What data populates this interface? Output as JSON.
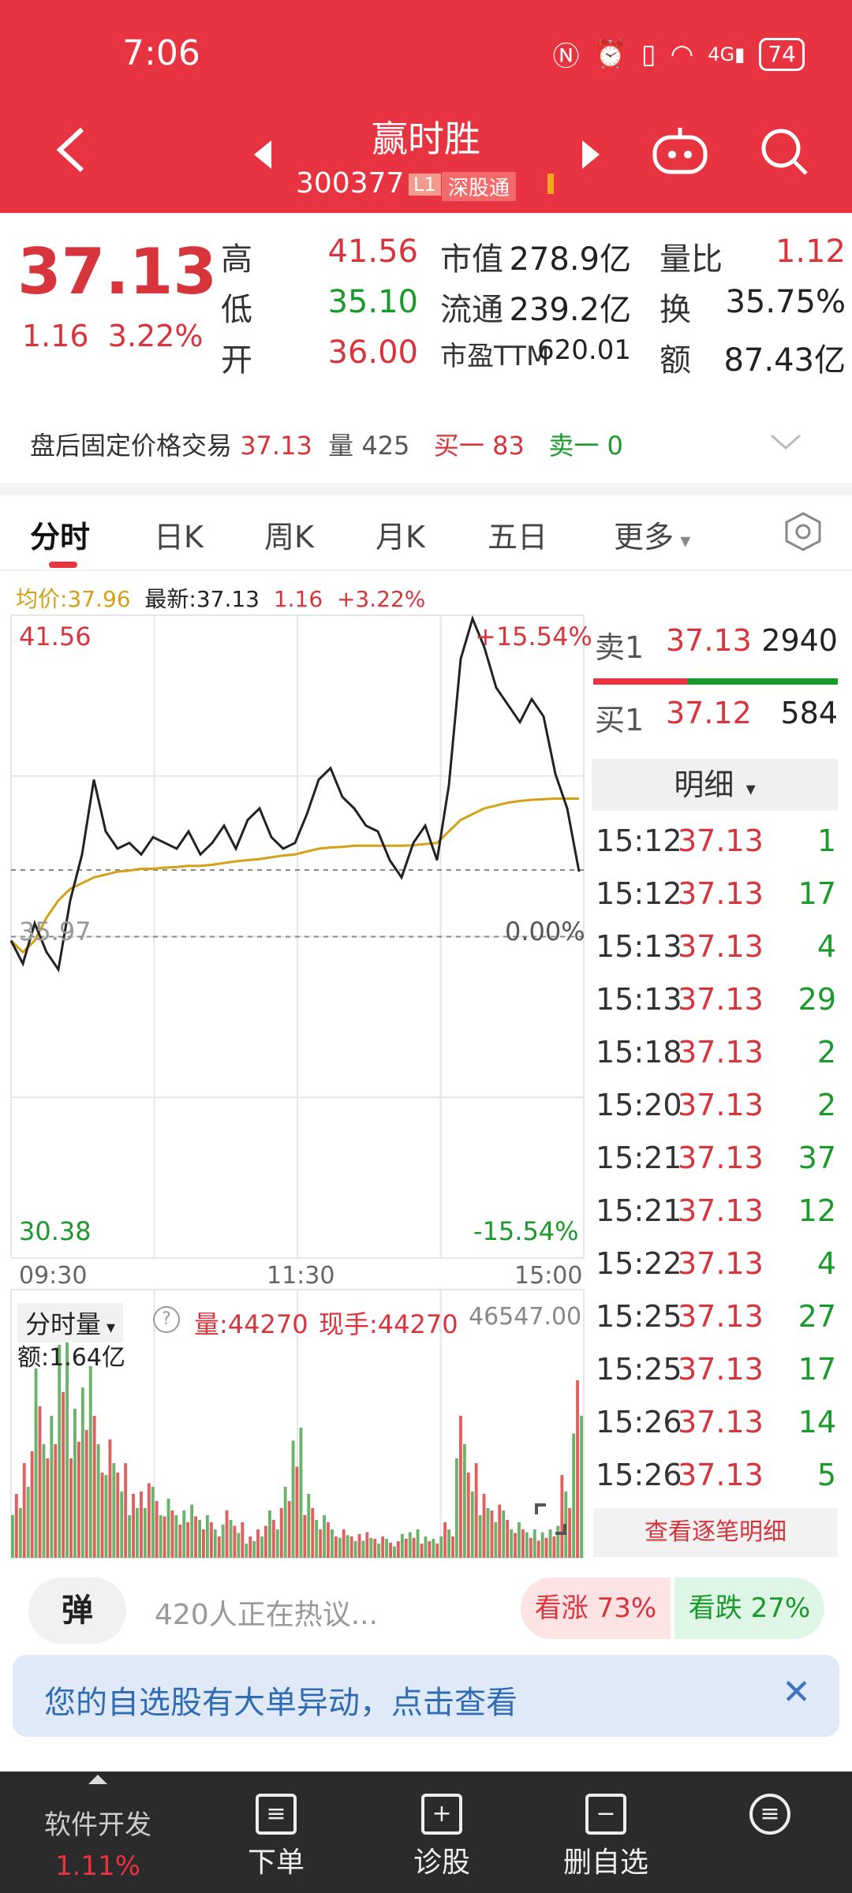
{
  "status_bar": {
    "time": "7:06",
    "icons": [
      "nfc-icon",
      "alarm-icon",
      "vibrate-icon",
      "wifi-icon",
      "signal-4g-icon"
    ],
    "battery": "74"
  },
  "header": {
    "name": "赢时胜",
    "code": "300377",
    "tag_level": "L1",
    "tag_market": "深股通",
    "accent": "#e83440"
  },
  "quote": {
    "price": "37.13",
    "change": "1.16",
    "change_pct": "3.22%",
    "stats": [
      {
        "label": "高",
        "value": "41.56",
        "color": "red"
      },
      {
        "label": "低",
        "value": "35.10",
        "color": "green"
      },
      {
        "label": "开",
        "value": "36.00",
        "color": "red"
      }
    ],
    "stats2": [
      {
        "label": "市值",
        "value": "278.9亿"
      },
      {
        "label": "流通",
        "value": "239.2亿"
      },
      {
        "label": "市盈TTM",
        "value": "620.01"
      }
    ],
    "stats3": [
      {
        "label": "量比",
        "value": "1.12"
      },
      {
        "label": "换",
        "value": "35.75%"
      },
      {
        "label": "额",
        "value": "87.43亿"
      }
    ]
  },
  "after_hours": {
    "label": "盘后固定价格交易",
    "price": "37.13",
    "vol_label": "量",
    "vol": "425",
    "buy_label": "买一",
    "buy": "83",
    "sell_label": "卖一",
    "sell": "0"
  },
  "tabs": [
    "分时",
    "日K",
    "周K",
    "月K",
    "五日",
    "更多"
  ],
  "chart_info": {
    "avg_label": "均价:37.96",
    "latest_label": "最新:37.13",
    "chg": "1.16",
    "pct": "+3.22%"
  },
  "chart_data": {
    "type": "line",
    "high_label": "41.56",
    "low_label": "30.38",
    "mid_label": "35.97",
    "high_pct": "+15.54%",
    "low_pct": "-15.54%",
    "mid_pct": "0.00%",
    "x_ticks": [
      "09:30",
      "11:30",
      "15:00"
    ],
    "ylim": [
      30.38,
      41.56
    ],
    "series": [
      {
        "name": "最新",
        "values": [
          35.9,
          35.5,
          36.2,
          35.7,
          35.4,
          36.6,
          37.4,
          38.7,
          37.8,
          37.5,
          37.6,
          37.4,
          37.7,
          37.6,
          37.5,
          37.8,
          37.4,
          37.6,
          37.9,
          37.5,
          38.0,
          38.2,
          37.7,
          37.5,
          37.6,
          38.1,
          38.7,
          38.9,
          38.4,
          38.2,
          37.9,
          37.8,
          37.3,
          37.0,
          37.6,
          37.9,
          37.3,
          38.6,
          40.8,
          41.5,
          41.0,
          40.3,
          40.0,
          39.7,
          40.1,
          39.8,
          38.8,
          38.2,
          37.1
        ]
      },
      {
        "name": "均价",
        "values": [
          35.9,
          35.7,
          35.9,
          36.3,
          36.6,
          36.8,
          36.9,
          37.0,
          37.05,
          37.1,
          37.12,
          37.15,
          37.15,
          37.17,
          37.18,
          37.2,
          37.2,
          37.22,
          37.25,
          37.28,
          37.3,
          37.32,
          37.35,
          37.38,
          37.4,
          37.45,
          37.5,
          37.52,
          37.53,
          37.55,
          37.55,
          37.55,
          37.55,
          37.55,
          37.56,
          37.58,
          37.6,
          37.8,
          38.0,
          38.1,
          38.2,
          38.25,
          38.3,
          38.33,
          38.35,
          38.36,
          38.37,
          38.37,
          38.37
        ]
      }
    ]
  },
  "volume": {
    "label": "分时量",
    "vol_label": "量:44270",
    "hand_label": "现手:44270",
    "max_label": "46547.00",
    "amount_label": "额:1.64亿",
    "bars": [
      0.3,
      0.5,
      0.8,
      0.6,
      1.0,
      0.7,
      0.9,
      0.6,
      0.5,
      0.4,
      0.3,
      0.35,
      0.3,
      0.25,
      0.2,
      0.25,
      0.2,
      0.15,
      0.2,
      0.15,
      0.1,
      0.15,
      0.2,
      0.3,
      0.55,
      0.3,
      0.2,
      0.15,
      0.12,
      0.1,
      0.12,
      0.1,
      0.08,
      0.1,
      0.12,
      0.1,
      0.1,
      0.15,
      0.6,
      0.4,
      0.3,
      0.25,
      0.2,
      0.15,
      0.12,
      0.12,
      0.15,
      0.35,
      0.75
    ]
  },
  "order_book": {
    "sell1": {
      "label": "卖1",
      "price": "37.13",
      "vol": "2940"
    },
    "buy1": {
      "label": "买1",
      "price": "37.12",
      "vol": "584"
    },
    "detail_label": "明细",
    "trades": [
      {
        "time": "15:12",
        "price": "37.13",
        "vol": "1"
      },
      {
        "time": "15:12",
        "price": "37.13",
        "vol": "17"
      },
      {
        "time": "15:13",
        "price": "37.13",
        "vol": "4"
      },
      {
        "time": "15:13",
        "price": "37.13",
        "vol": "29"
      },
      {
        "time": "15:18",
        "price": "37.13",
        "vol": "2"
      },
      {
        "time": "15:20",
        "price": "37.13",
        "vol": "2"
      },
      {
        "time": "15:21",
        "price": "37.13",
        "vol": "37"
      },
      {
        "time": "15:21",
        "price": "37.13",
        "vol": "12"
      },
      {
        "time": "15:22",
        "price": "37.13",
        "vol": "4"
      },
      {
        "time": "15:25",
        "price": "37.13",
        "vol": "27"
      },
      {
        "time": "15:25",
        "price": "37.13",
        "vol": "17"
      },
      {
        "time": "15:26",
        "price": "37.13",
        "vol": "14"
      },
      {
        "time": "15:26",
        "price": "37.13",
        "vol": "5"
      }
    ],
    "more_label": "查看逐笔明细"
  },
  "discussion": {
    "bullet": "弹",
    "text": "420人正在热议...",
    "up": "看涨 73%",
    "down": "看跌 27%"
  },
  "notice": {
    "text": "您的自选股有大单异动，点击查看"
  },
  "nav": {
    "sector": "软件开发",
    "sector_pct": "1.11%",
    "items": [
      "下单",
      "诊股",
      "删自选"
    ]
  }
}
